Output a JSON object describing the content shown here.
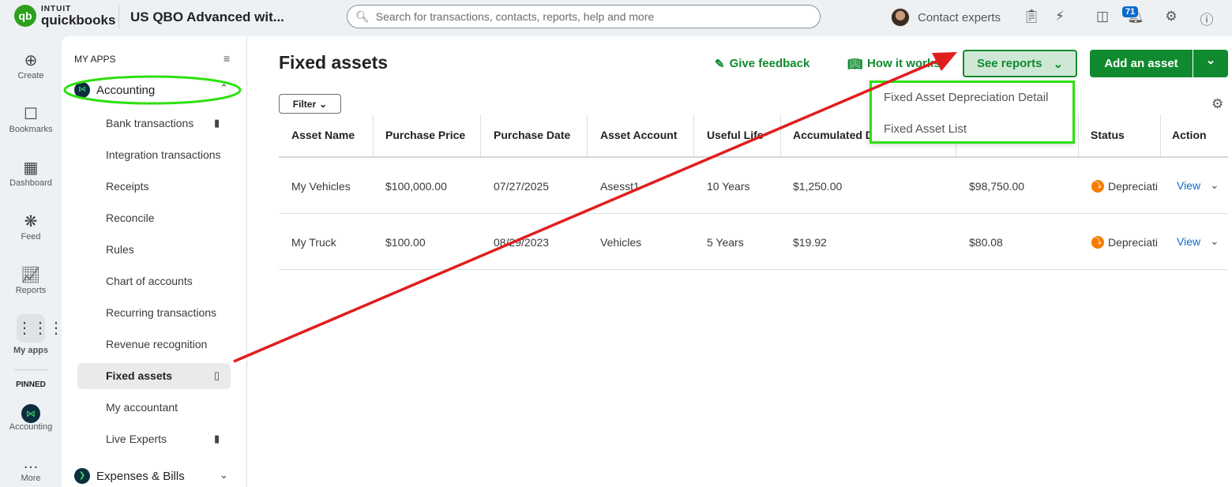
{
  "header": {
    "logo_brand": "INTUIT",
    "logo_product": "quickbooks",
    "company": "US QBO Advanced wit...",
    "search_placeholder": "Search for transactions, contacts, reports, help and more",
    "contact": "Contact experts",
    "notifications": "71"
  },
  "rail": {
    "items": [
      "Create",
      "Bookmarks",
      "Dashboard",
      "Feed",
      "Reports",
      "My apps"
    ],
    "pinned_label": "PINNED",
    "pinned": [
      "Accounting"
    ],
    "more": "More"
  },
  "sidebar": {
    "title": "MY APPS",
    "section": "Accounting",
    "items": [
      "Bank transactions",
      "Integration transactions",
      "Receipts",
      "Reconcile",
      "Rules",
      "Chart of accounts",
      "Recurring transactions",
      "Revenue recognition",
      "Fixed assets",
      "My accountant",
      "Live Experts"
    ],
    "next_section": "Expenses & Bills"
  },
  "page": {
    "title": "Fixed assets",
    "feedback": "Give feedback",
    "how": "How it works",
    "see_reports": "See reports",
    "add_asset": "Add an asset",
    "filter": "Filter"
  },
  "reports_menu": [
    "Fixed Asset Depreciation Detail",
    "Fixed Asset List"
  ],
  "table": {
    "headers": [
      "Asset Name",
      "Purchase Price",
      "Purchase Date",
      "Asset Account",
      "Useful Life",
      "Accumulated D",
      "",
      "Status",
      "Action"
    ],
    "rows": [
      [
        "My Vehicles",
        "$100,000.00",
        "07/27/2025",
        "Asesst1",
        "10 Years",
        "$1,250.00",
        "$98,750.00",
        "Depreciati",
        "View"
      ],
      [
        "My Truck",
        "$100.00",
        "08/29/2023",
        "Vehicles",
        "5 Years",
        "$19.92",
        "$80.08",
        "Depreciati",
        "View"
      ]
    ]
  },
  "colors": {
    "brand_green": "#2ca01c",
    "button_green": "#108a2f",
    "annotation_green": "#2ee010",
    "arrow_red": "#e01e1e",
    "status_orange": "#f57c00",
    "link_blue": "#0b6bcb"
  }
}
